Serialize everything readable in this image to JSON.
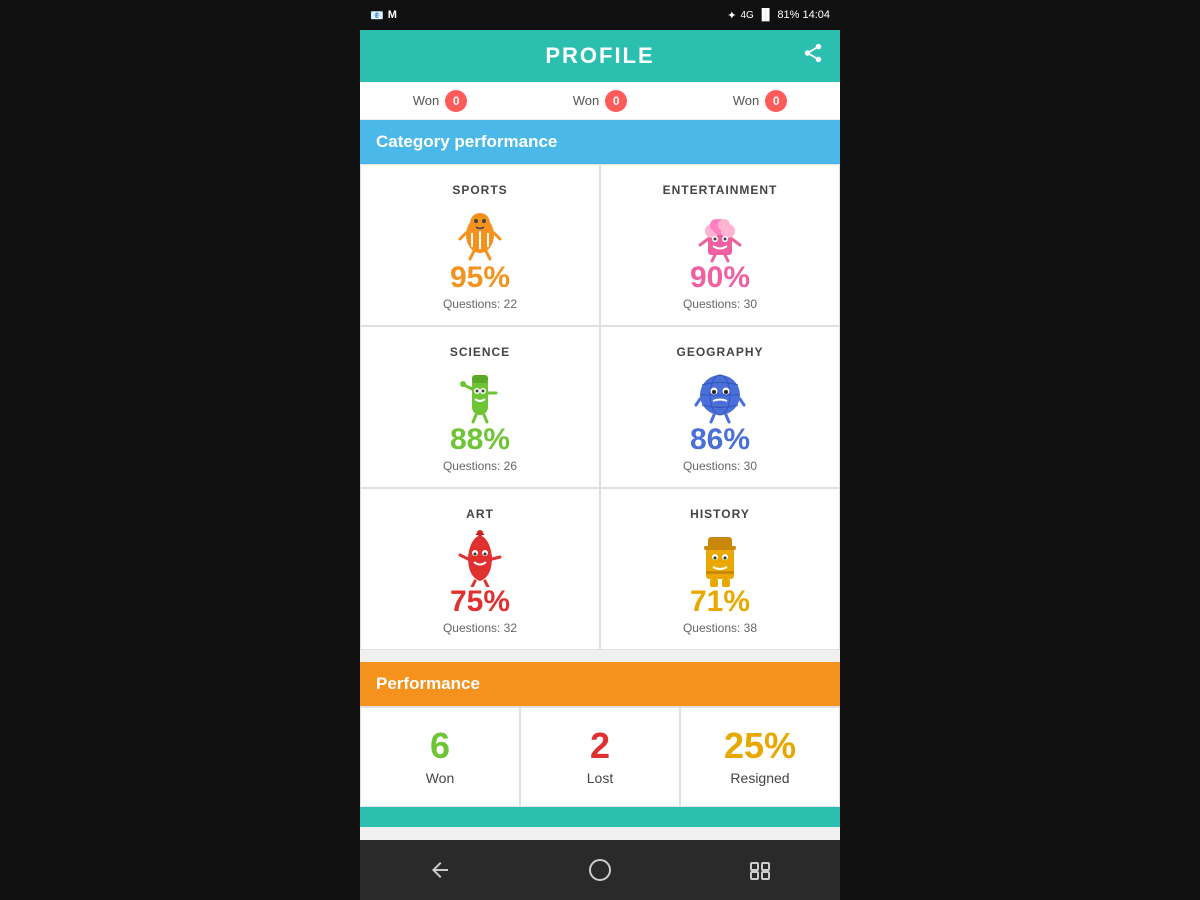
{
  "statusBar": {
    "left": [
      "📧",
      "M"
    ],
    "right": "81%  14:04"
  },
  "header": {
    "title": "PROFILE",
    "shareIcon": "share"
  },
  "wonStrip": [
    {
      "label": "Won",
      "count": "0"
    },
    {
      "label": "Won",
      "count": "0"
    },
    {
      "label": "Won",
      "count": "0"
    }
  ],
  "categoryPerformance": {
    "sectionTitle": "Category performance",
    "categories": [
      {
        "name": "SPORTS",
        "percent": "95%",
        "questions": "Questions: 22",
        "color": "color-orange",
        "mascotType": "sports"
      },
      {
        "name": "ENTERTAINMENT",
        "percent": "90%",
        "questions": "Questions: 30",
        "color": "color-pink",
        "mascotType": "entertainment"
      },
      {
        "name": "SCIENCE",
        "percent": "88%",
        "questions": "Questions: 26",
        "color": "color-green",
        "mascotType": "science"
      },
      {
        "name": "GEOGRAPHY",
        "percent": "86%",
        "questions": "Questions: 30",
        "color": "color-blue",
        "mascotType": "geography"
      },
      {
        "name": "ART",
        "percent": "75%",
        "questions": "Questions: 32",
        "color": "color-red",
        "mascotType": "art"
      },
      {
        "name": "HISTORY",
        "percent": "71%",
        "questions": "Questions: 38",
        "color": "color-yellow",
        "mascotType": "history"
      }
    ]
  },
  "performance": {
    "sectionTitle": "Performance",
    "stats": [
      {
        "value": "6",
        "label": "Won",
        "color": "color-green"
      },
      {
        "value": "2",
        "label": "Lost",
        "color": "color-red"
      },
      {
        "value": "25%",
        "label": "Resigned",
        "color": "color-yellow"
      }
    ]
  }
}
